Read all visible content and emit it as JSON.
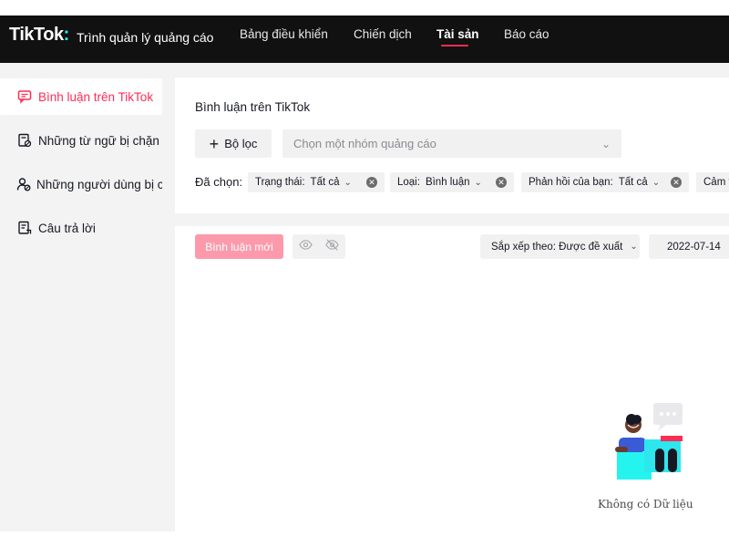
{
  "topbar": {
    "logo": "TikTok",
    "logo_dot": ":",
    "subtitle": "Trình quản lý quảng cáo",
    "nav": [
      {
        "label": "Bảng điều khiển"
      },
      {
        "label": "Chiến dịch"
      },
      {
        "label": "Tài sản",
        "active": true
      },
      {
        "label": "Báo cáo"
      }
    ]
  },
  "sidebar": {
    "items": [
      {
        "label": "Bình luận trên TikTok",
        "icon": "comment-icon",
        "active": true
      },
      {
        "label": "Những từ ngữ bị chặn",
        "icon": "blocked-words-icon"
      },
      {
        "label": "Những người dùng bị chặn",
        "icon": "blocked-users-icon"
      },
      {
        "label": "Câu trả lời",
        "icon": "replies-icon"
      }
    ]
  },
  "filters": {
    "title": "Bình luận trên TikTok",
    "filter_button": "Bộ lọc",
    "group_placeholder": "Chọn một nhóm quảng cáo",
    "selected_label": "Đã chọn:",
    "chips": [
      {
        "key": "Trạng thái:",
        "value": "Tất cả"
      },
      {
        "key": "Loại:",
        "value": "Bình luận"
      },
      {
        "key": "Phản hồi của bạn:",
        "value": "Tất cả"
      },
      {
        "key": "Cảm t",
        "value": ""
      }
    ]
  },
  "toolbar": {
    "new_comment": "Bình luận mới",
    "sort_label": "Sắp xếp theo: Được đề xuất",
    "date": "2022-07-14"
  },
  "empty": {
    "text": "Không có Dữ liệu"
  },
  "colors": {
    "accent": "#fe2c55",
    "accent_light": "#fc9aac",
    "topbar_bg": "#111111"
  }
}
